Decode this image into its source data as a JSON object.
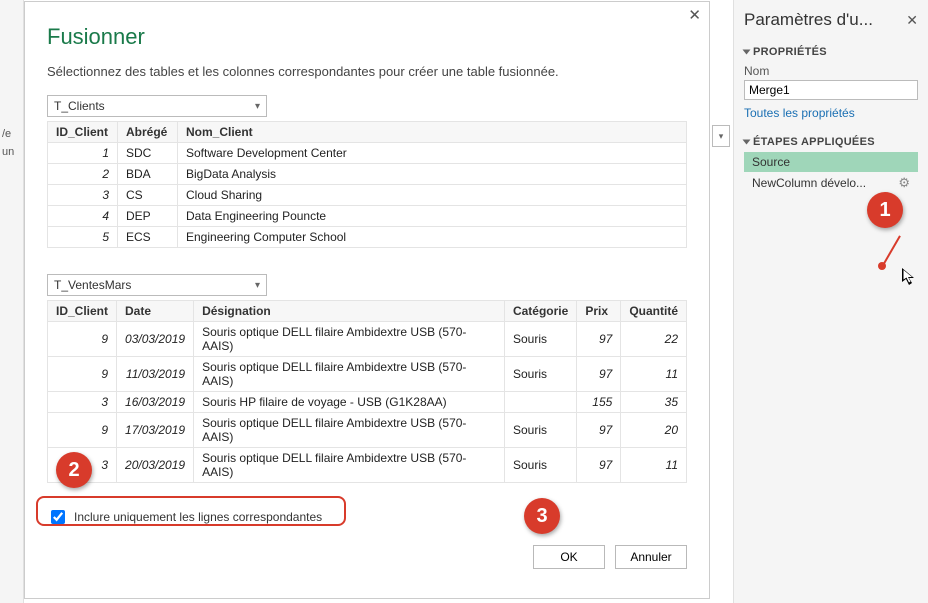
{
  "dialog": {
    "title": "Fusionner",
    "subtitle": "Sélectionnez des tables et les colonnes correspondantes pour créer une table fusionnée.",
    "combo1": "T_Clients",
    "combo2": "T_VentesMars",
    "table1": {
      "headers": [
        "ID_Client",
        "Abrégé",
        "Nom_Client"
      ],
      "rows": [
        {
          "id": "1",
          "abr": "SDC",
          "nom": "Software Development Center"
        },
        {
          "id": "2",
          "abr": "BDA",
          "nom": "BigData Analysis"
        },
        {
          "id": "3",
          "abr": "CS",
          "nom": "Cloud Sharing"
        },
        {
          "id": "4",
          "abr": "DEP",
          "nom": "Data Engineering Pouncte"
        },
        {
          "id": "5",
          "abr": "ECS",
          "nom": "Engineering Computer School"
        }
      ]
    },
    "table2": {
      "headers": [
        "ID_Client",
        "Date",
        "Désignation",
        "Catégorie",
        "Prix",
        "Quantité"
      ],
      "rows": [
        {
          "id": "9",
          "date": "03/03/2019",
          "des": "Souris optique DELL filaire Ambidextre USB (570-AAIS)",
          "cat": "Souris",
          "prix": "97",
          "q": "22"
        },
        {
          "id": "9",
          "date": "11/03/2019",
          "des": "Souris optique DELL filaire Ambidextre USB (570-AAIS)",
          "cat": "Souris",
          "prix": "97",
          "q": "11"
        },
        {
          "id": "3",
          "date": "16/03/2019",
          "des": "Souris HP filaire de voyage - USB (G1K28AA)",
          "cat": "",
          "prix": "155",
          "q": "35"
        },
        {
          "id": "9",
          "date": "17/03/2019",
          "des": "Souris optique DELL filaire Ambidextre USB (570-AAIS)",
          "cat": "Souris",
          "prix": "97",
          "q": "20"
        },
        {
          "id": "3",
          "date": "20/03/2019",
          "des": "Souris optique DELL filaire Ambidextre USB (570-AAIS)",
          "cat": "Souris",
          "prix": "97",
          "q": "11"
        }
      ]
    },
    "checkbox_label": "Inclure uniquement les lignes correspondantes",
    "ok": "OK",
    "cancel": "Annuler"
  },
  "rpane": {
    "title": "Paramètres d'u...",
    "sect_props": "PROPRIÉTÉS",
    "name_label": "Nom",
    "name_value": "Merge1",
    "all_props": "Toutes les propriétés",
    "sect_steps": "ÉTAPES APPLIQUÉES",
    "steps": [
      {
        "label": "Source"
      },
      {
        "label": "NewColumn dévelo..."
      }
    ]
  },
  "annotations": {
    "b1": "1",
    "b2": "2",
    "b3": "3"
  },
  "leftstrip": {
    "l1": "/e",
    "l2": "un"
  }
}
